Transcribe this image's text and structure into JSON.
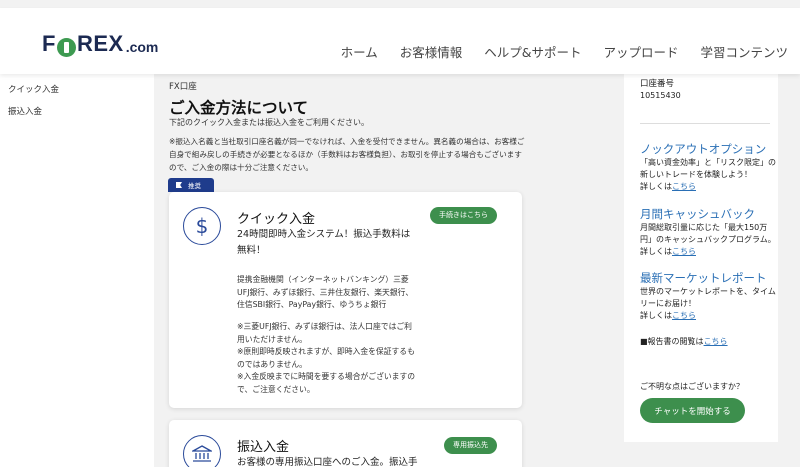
{
  "header": {
    "logo_left": "F",
    "logo_right": "REX",
    "logo_suffix": ".com",
    "nav": [
      "ホーム",
      "お客様情報",
      "ヘルプ&サポート",
      "アップロード",
      "学習コンテンツ"
    ]
  },
  "sidebar": {
    "items": [
      "クイック入金",
      "振込入金"
    ]
  },
  "main": {
    "breadcrumb": "FX口座",
    "title": "ご入金方法について",
    "subtitle": "下記のクイック入金または振込入金をご利用ください。",
    "notice": "※振込入名義と当社取引口座名義が同一でなければ、入金を受付できません。異名義の場合は、お客様ご自身で組み戻しの手続きが必要となるほか（手数料はお客様負担）、お取引を停止する場合もございますので、ご入金の際は十分ご注意ください。",
    "badge": "推奨",
    "card1": {
      "icon": "dollar-icon",
      "title": "クイック入金",
      "button": "手続きはこちら",
      "lead": "24時間即時入金システム！振込手数料は無料！",
      "banks": "提携金融機関（インターネットバンキング）三菱UFJ銀行、みずほ銀行、三井住友銀行、楽天銀行、住信SBI銀行、PayPay銀行、ゆうちょ銀行",
      "note1": "※三菱UFJ銀行、みずほ銀行は、法人口座ではご利用いただけません。",
      "note2": "※原則即時反映されますが、即時入金を保証するものではありません。",
      "note3": "※入金反映までに時間を要する場合がございますので、ご注意ください。"
    },
    "card2": {
      "icon": "bank-icon",
      "title": "振込入金",
      "button": "専用振込先",
      "lead": "お客様の専用振込口座へのご入金。振込手"
    }
  },
  "right": {
    "account_label": "口座番号",
    "account_number": "10515430",
    "promos": [
      {
        "title": "ノックアウトオプション",
        "desc": "「高い資金効率」と「リスク限定」の新しいトレードを体験しよう！",
        "detail": "詳しくは",
        "link": "こちら"
      },
      {
        "title": "月間キャッシュバック",
        "desc": "月間総取引量に応じた「最大150万円」のキャッシュバックプログラム。",
        "detail": "詳しくは",
        "link": "こちら"
      },
      {
        "title": "最新マーケットレポート",
        "desc": "世界のマーケットレポートを、タイムリーにお届け！",
        "detail": "詳しくは",
        "link": "こちら"
      }
    ],
    "report_note": "■報告書の閲覧は",
    "report_link": "こちら",
    "question": "ご不明な点はございますか？",
    "chat_button": "チャットを開始する"
  },
  "colors": {
    "brand_navy": "#1c2a52",
    "brand_green": "#3d9a51",
    "link_blue": "#2a6fb5",
    "badge_blue": "#1f3c8c"
  }
}
